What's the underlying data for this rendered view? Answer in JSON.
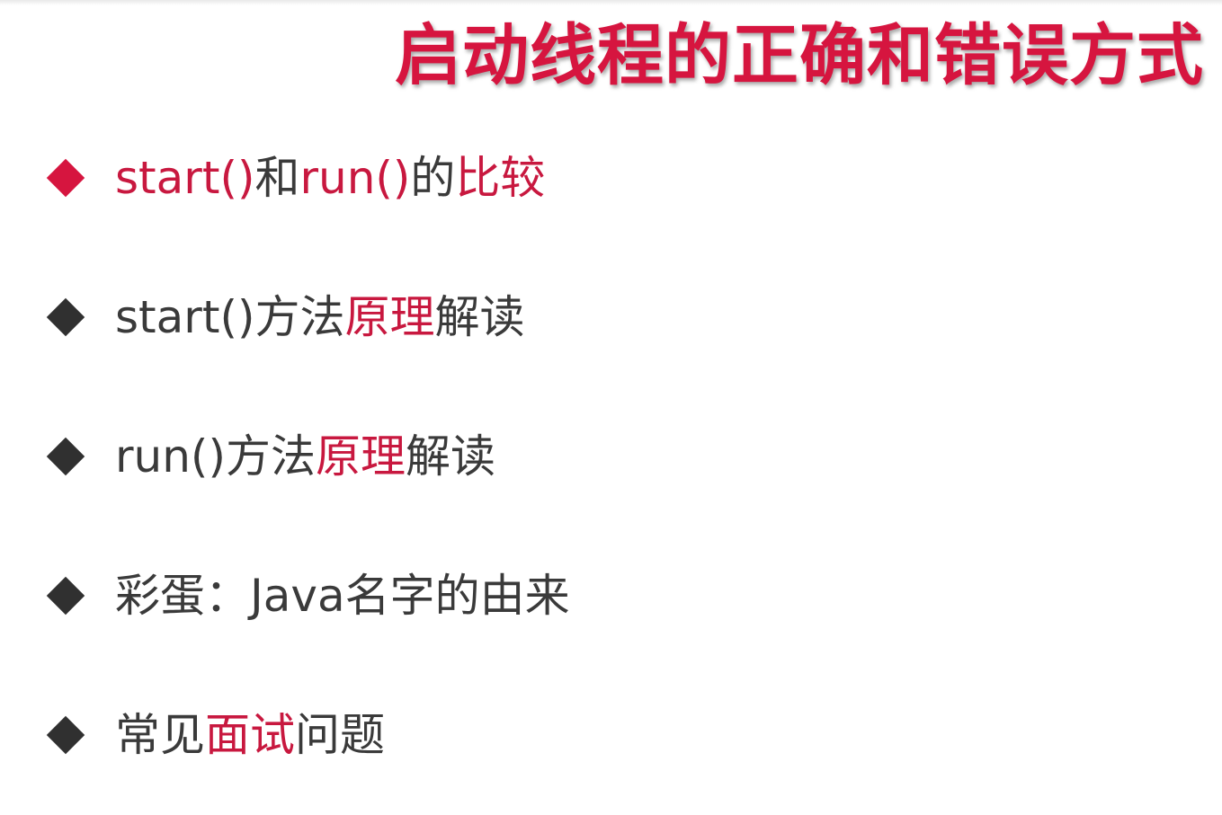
{
  "title": "启动线程的正确和错误方式",
  "colors": {
    "accent": "#d6153f",
    "text": "#3a3a3a",
    "bullet_dark": "#303030"
  },
  "bullets": [
    {
      "icon": "diamond-bullet-icon",
      "icon_color": "red",
      "segments": [
        {
          "text": "start()",
          "color": "red"
        },
        {
          "text": "和",
          "color": "dark"
        },
        {
          "text": "run()",
          "color": "red"
        },
        {
          "text": "的",
          "color": "dark"
        },
        {
          "text": "比较",
          "color": "red"
        }
      ]
    },
    {
      "icon": "diamond-bullet-icon",
      "icon_color": "dark",
      "segments": [
        {
          "text": "start()方法",
          "color": "dark"
        },
        {
          "text": "原理",
          "color": "red"
        },
        {
          "text": "解读",
          "color": "dark"
        }
      ]
    },
    {
      "icon": "diamond-bullet-icon",
      "icon_color": "dark",
      "segments": [
        {
          "text": "run()方法",
          "color": "dark"
        },
        {
          "text": "原理",
          "color": "red"
        },
        {
          "text": "解读",
          "color": "dark"
        }
      ]
    },
    {
      "icon": "diamond-bullet-icon",
      "icon_color": "dark",
      "segments": [
        {
          "text": "彩蛋：Java名字的由来",
          "color": "dark"
        }
      ]
    },
    {
      "icon": "diamond-bullet-icon",
      "icon_color": "dark",
      "segments": [
        {
          "text": "常见",
          "color": "dark"
        },
        {
          "text": "面试",
          "color": "red"
        },
        {
          "text": "问题",
          "color": "dark"
        }
      ]
    }
  ]
}
